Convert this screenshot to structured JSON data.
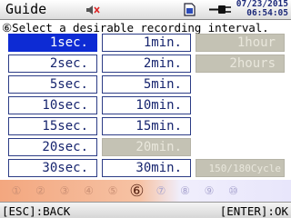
{
  "header": {
    "title": "Guide",
    "icons": [
      "mute-speaker-icon",
      "sd-card-icon",
      "ac-plug-icon"
    ],
    "date": "07/23/2015",
    "time": "06:54:05"
  },
  "instruction": {
    "step_symbol": "⑥",
    "text": "Select a desirable recording interval."
  },
  "intervals": [
    [
      {
        "label": "1sec.",
        "state": "selected"
      },
      {
        "label": "2sec.",
        "state": "enabled"
      },
      {
        "label": "5sec.",
        "state": "enabled"
      },
      {
        "label": "10sec.",
        "state": "enabled"
      },
      {
        "label": "15sec.",
        "state": "enabled"
      },
      {
        "label": "20sec.",
        "state": "enabled"
      },
      {
        "label": "30sec.",
        "state": "enabled"
      }
    ],
    [
      {
        "label": "1min.",
        "state": "enabled"
      },
      {
        "label": "2min.",
        "state": "enabled"
      },
      {
        "label": "5min.",
        "state": "enabled"
      },
      {
        "label": "10min.",
        "state": "enabled"
      },
      {
        "label": "15min.",
        "state": "enabled"
      },
      {
        "label": "20min.",
        "state": "disabled"
      },
      {
        "label": "30min.",
        "state": "enabled"
      }
    ],
    [
      {
        "label": "1hour",
        "state": "disabled"
      },
      {
        "label": "2hours",
        "state": "disabled"
      },
      {
        "label": "",
        "state": "blank"
      },
      {
        "label": "",
        "state": "blank"
      },
      {
        "label": "",
        "state": "blank"
      },
      {
        "label": "",
        "state": "blank"
      },
      {
        "label": "150/180Cycle",
        "state": "disabled"
      }
    ]
  ],
  "progress": {
    "steps": [
      "①",
      "②",
      "③",
      "④",
      "⑤",
      "⑥",
      "⑦",
      "⑧",
      "⑨",
      "⑩"
    ],
    "current_step": 6,
    "colors": {
      "done": "#f3a77f",
      "upcoming": "#e8e6fb"
    }
  },
  "footer": {
    "left": "[ESC]:BACK",
    "right": "[ENTER]:OK"
  },
  "colors": {
    "selected": "#0d2bd4",
    "cell_border": "#2c3c86",
    "disabled": "#c4c2b4"
  }
}
